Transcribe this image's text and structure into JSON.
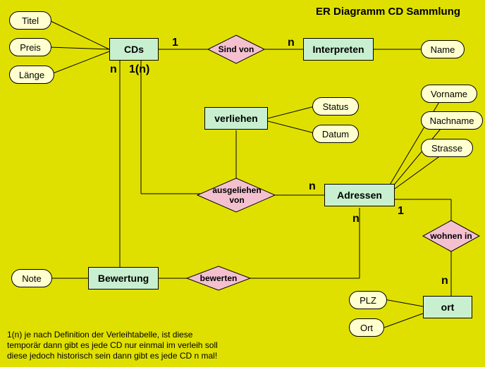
{
  "title": "ER Diagramm CD Sammlung",
  "entities": {
    "cds": "CDs",
    "interpreten": "Interpreten",
    "verliehen": "verliehen",
    "adressen": "Adressen",
    "bewertung": "Bewertung",
    "ort": "ort"
  },
  "relations": {
    "sind_von": "Sind von",
    "ausgeliehen_von_l1": "ausgeliehen",
    "ausgeliehen_von_l2": "von",
    "bewerten": "bewerten",
    "wohnen_in": "wohnen in"
  },
  "attrs": {
    "titel": "Titel",
    "preis": "Preis",
    "laenge": "Länge",
    "name": "Name",
    "status": "Status",
    "datum": "Datum",
    "vorname": "Vorname",
    "nachname": "Nachname",
    "strasse": "Strasse",
    "note": "Note",
    "plz": "PLZ",
    "ort_attr": "Ort"
  },
  "card": {
    "cds_sind_von": "1",
    "interpreten_sind_von": "n",
    "cds_verliehen": "1(n)",
    "cds_bewerten": "n",
    "adressen_ausgeliehen": "n",
    "adressen_bewerten": "n",
    "adressen_wohnen": "1",
    "ort_wohnen": "n"
  },
  "footnote_l1": "1(n) je nach Definition der Verleihtabelle, ist diese",
  "footnote_l2": "temporär  dann gibt es jede CD nur einmal im verleih soll",
  "footnote_l3": "diese jedoch historisch sein dann gibt es jede CD n mal!"
}
